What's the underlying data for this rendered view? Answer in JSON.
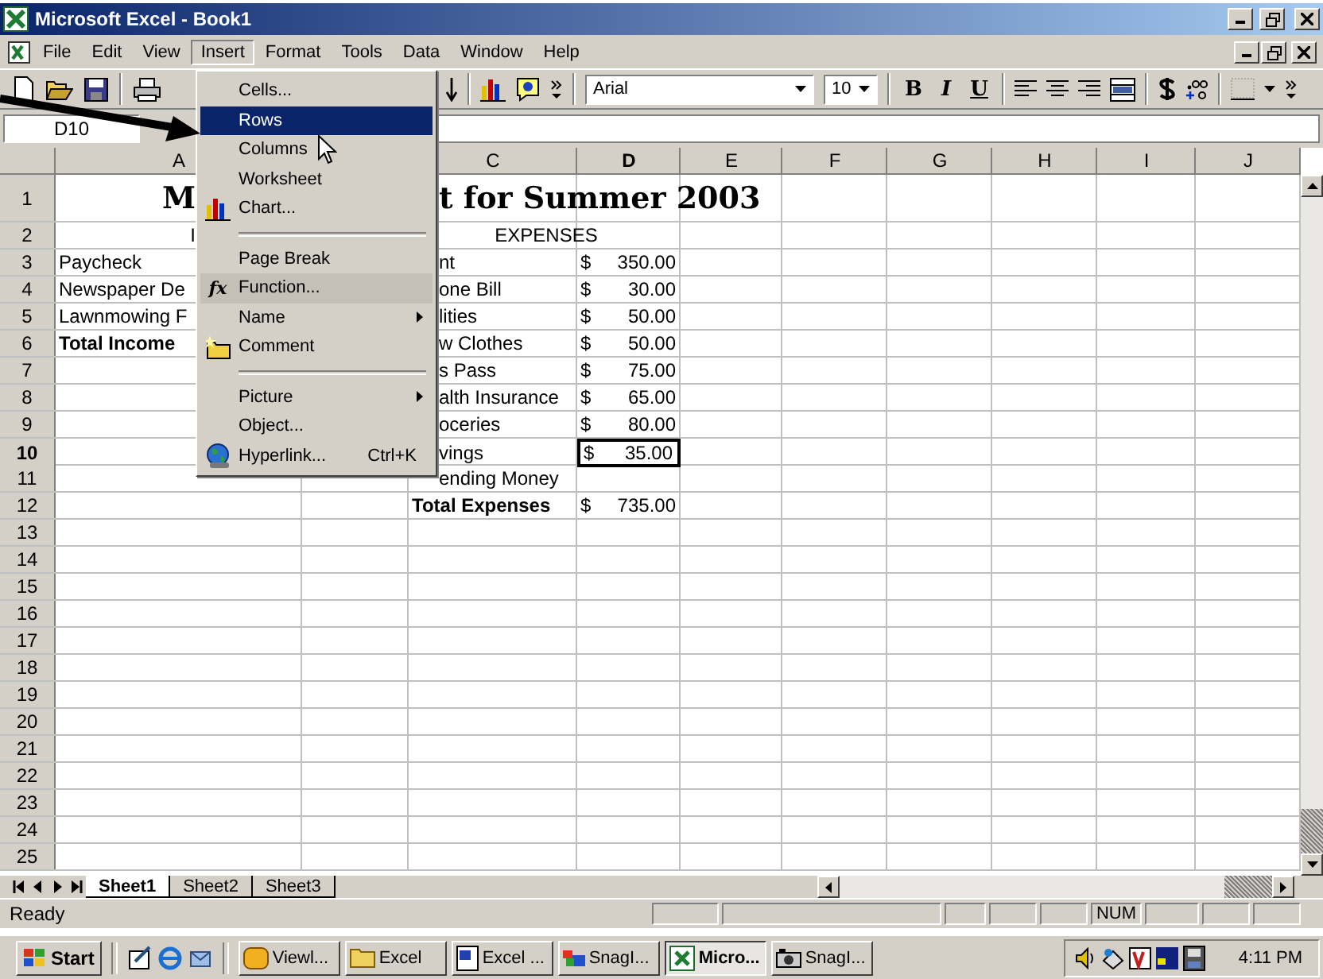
{
  "window": {
    "title": "Microsoft Excel - Book1"
  },
  "menu_bar": [
    {
      "label": "File",
      "selected": false
    },
    {
      "label": "Edit",
      "selected": false
    },
    {
      "label": "View",
      "selected": false
    },
    {
      "label": "Insert",
      "selected": true
    },
    {
      "label": "Format",
      "selected": false
    },
    {
      "label": "Tools",
      "selected": false
    },
    {
      "label": "Data",
      "selected": false
    },
    {
      "label": "Window",
      "selected": false
    },
    {
      "label": "Help",
      "selected": false
    }
  ],
  "insert_menu": [
    {
      "label": "Cells...",
      "kind": "item",
      "selected": false,
      "highlighted": false
    },
    {
      "label": "Rows",
      "kind": "item",
      "selected": true,
      "highlighted": false
    },
    {
      "label": "Columns",
      "kind": "item",
      "selected": false,
      "highlighted": false
    },
    {
      "label": "Worksheet",
      "kind": "item",
      "selected": false,
      "highlighted": false
    },
    {
      "label": "Chart...",
      "kind": "item",
      "selected": false,
      "highlighted": false
    },
    {
      "kind": "separator"
    },
    {
      "label": "Page Break",
      "kind": "item",
      "selected": false,
      "highlighted": false
    },
    {
      "label": "Function...",
      "kind": "item",
      "glyph": "fx",
      "selected": false,
      "highlighted": true
    },
    {
      "label": "Name",
      "kind": "submenu",
      "selected": false,
      "highlighted": false
    },
    {
      "label": "Comment",
      "kind": "item",
      "selected": false,
      "highlighted": false
    },
    {
      "kind": "separator"
    },
    {
      "label": "Picture",
      "kind": "submenu",
      "selected": false,
      "highlighted": false
    },
    {
      "label": "Object...",
      "kind": "item",
      "selected": false,
      "highlighted": false
    },
    {
      "label": "Hyperlink...",
      "kind": "item",
      "shortcut": "Ctrl+K",
      "selected": false,
      "highlighted": false
    }
  ],
  "toolbar": {
    "font": "Arial",
    "size": "10",
    "format_buttons": [
      "B",
      "I",
      "U"
    ]
  },
  "name_box": "D10",
  "columns": [
    {
      "label": "A",
      "selected": false
    },
    {
      "label": "C",
      "selected": false
    },
    {
      "label": "D",
      "selected": true
    },
    {
      "label": "E",
      "selected": false
    },
    {
      "label": "F",
      "selected": false
    },
    {
      "label": "G",
      "selected": false
    },
    {
      "label": "H",
      "selected": false
    },
    {
      "label": "I",
      "selected": false
    },
    {
      "label": "J",
      "selected": false
    }
  ],
  "rows": [
    {
      "num": "1",
      "a": {
        "text": "M",
        "kind": "title",
        "centered": true
      },
      "c": {
        "text": "t for Summer 2003",
        "kind": "title",
        "cut": true,
        "merge": true
      }
    },
    {
      "num": "2",
      "a": {
        "text": "I",
        "kind": "text",
        "centered": true
      },
      "c": {
        "text": "EXPENSES",
        "kind": "text",
        "cut": false,
        "merge": true
      }
    },
    {
      "num": "3",
      "a": {
        "text": "Paycheck",
        "kind": "text",
        "centered": false
      },
      "c": {
        "text": "nt",
        "kind": "text",
        "cut": true,
        "merge": false
      },
      "d": {
        "sym": "$",
        "amt": "350.00",
        "selected": false
      }
    },
    {
      "num": "4",
      "a": {
        "text": "Newspaper De",
        "kind": "text",
        "centered": false
      },
      "c": {
        "text": "one Bill",
        "kind": "text",
        "cut": true,
        "merge": false
      },
      "d": {
        "sym": "$",
        "amt": "30.00",
        "selected": false
      }
    },
    {
      "num": "5",
      "a": {
        "text": "Lawnmowing F",
        "kind": "text",
        "centered": false
      },
      "c": {
        "text": "lities",
        "kind": "text",
        "cut": true,
        "merge": false
      },
      "d": {
        "sym": "$",
        "amt": "50.00",
        "selected": false
      }
    },
    {
      "num": "6",
      "a": {
        "text": "Total Income",
        "kind": "total",
        "centered": false
      },
      "c": {
        "text": "w Clothes",
        "kind": "text",
        "cut": true,
        "merge": false
      },
      "d": {
        "sym": "$",
        "amt": "50.00",
        "selected": false
      }
    },
    {
      "num": "7",
      "c": {
        "text": "s Pass",
        "kind": "text",
        "cut": true,
        "merge": false
      },
      "d": {
        "sym": "$",
        "amt": "75.00",
        "selected": false
      }
    },
    {
      "num": "8",
      "c": {
        "text": "alth Insurance",
        "kind": "text",
        "cut": true,
        "merge": false
      },
      "d": {
        "sym": "$",
        "amt": "65.00",
        "selected": false
      }
    },
    {
      "num": "9",
      "c": {
        "text": "oceries",
        "kind": "text",
        "cut": true,
        "merge": false
      },
      "d": {
        "sym": "$",
        "amt": "80.00",
        "selected": false
      }
    },
    {
      "num": "10",
      "c": {
        "text": "vings",
        "kind": "text",
        "cut": true,
        "merge": false
      },
      "d": {
        "sym": "$",
        "amt": "35.00",
        "selected": true
      }
    },
    {
      "num": "11",
      "c": {
        "text": "ending Money",
        "kind": "text",
        "cut": true,
        "merge": false
      }
    },
    {
      "num": "12",
      "c": {
        "text": "Total Expenses",
        "kind": "total",
        "cut": false,
        "merge": false
      },
      "d": {
        "sym": "$",
        "amt": "735.00",
        "selected": false
      }
    },
    {
      "num": "13"
    },
    {
      "num": "14"
    },
    {
      "num": "15"
    },
    {
      "num": "16"
    },
    {
      "num": "17"
    },
    {
      "num": "18"
    },
    {
      "num": "19"
    },
    {
      "num": "20"
    },
    {
      "num": "21"
    },
    {
      "num": "22"
    },
    {
      "num": "23"
    },
    {
      "num": "24"
    },
    {
      "num": "25"
    }
  ],
  "sheet_tabs": [
    {
      "label": "Sheet1",
      "selected": true
    },
    {
      "label": "Sheet2",
      "selected": false
    },
    {
      "label": "Sheet3",
      "selected": false
    }
  ],
  "status_bar": {
    "text": "Ready",
    "indicators": [
      "NUM"
    ]
  },
  "taskbar": {
    "start": "Start",
    "tasks": [
      {
        "label": "Viewl...",
        "selected": false
      },
      {
        "label": "Excel",
        "selected": false
      },
      {
        "label": "Excel ...",
        "selected": false
      },
      {
        "label": "SnagI...",
        "selected": false
      },
      {
        "label": "Micro...",
        "selected": true
      },
      {
        "label": "SnagI...",
        "selected": false
      }
    ],
    "clock": "4:11 PM"
  }
}
